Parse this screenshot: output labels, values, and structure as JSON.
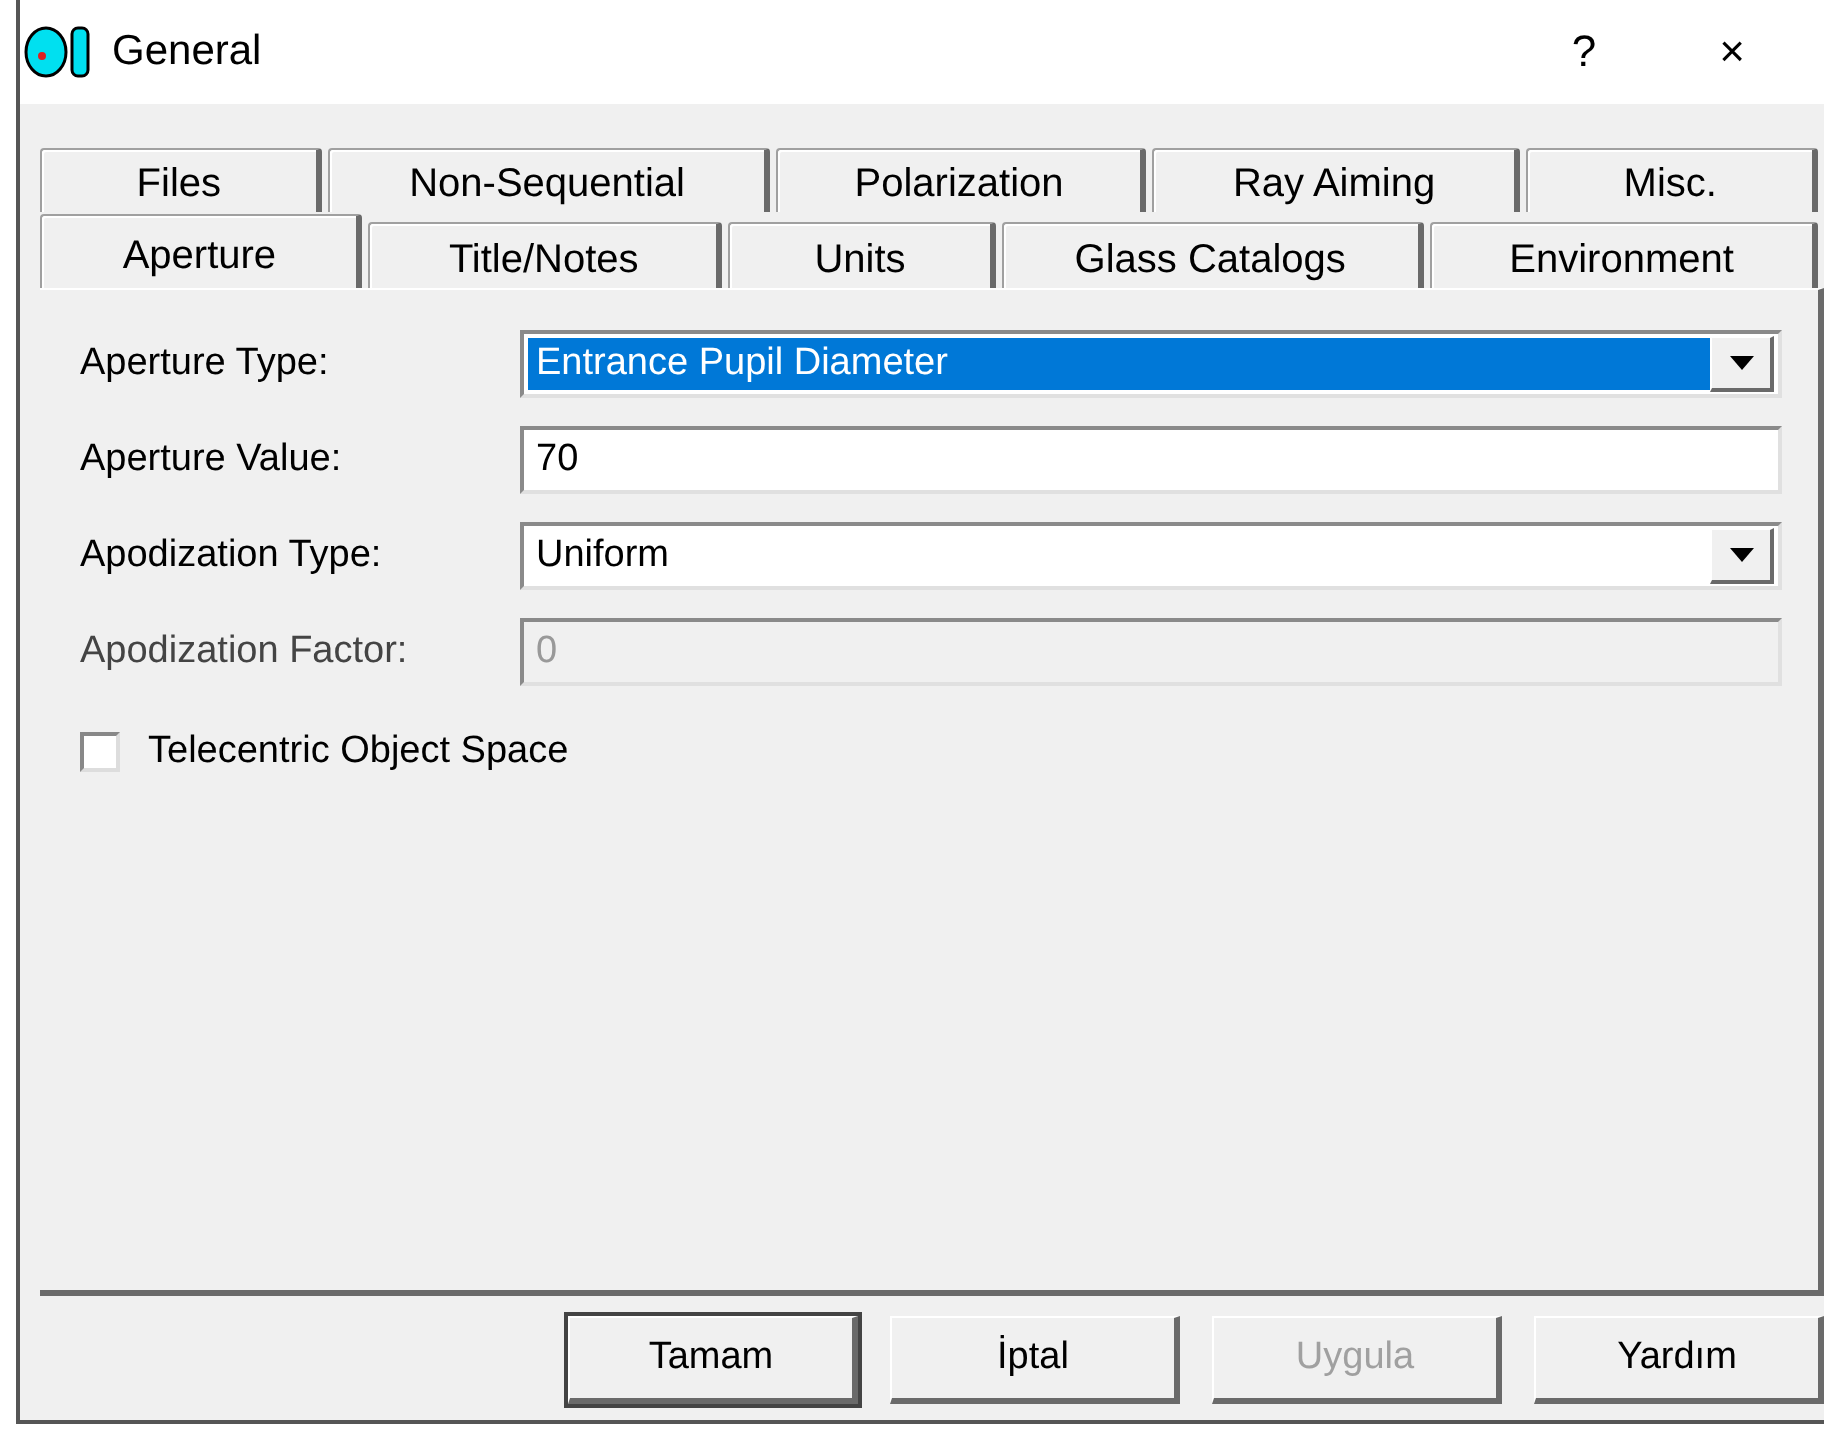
{
  "window": {
    "title": "General",
    "help": "?",
    "close": "×"
  },
  "tab_rows": [
    [
      {
        "label": "Files",
        "selected": false
      },
      {
        "label": "Non-Sequential",
        "selected": false
      },
      {
        "label": "Polarization",
        "selected": false
      },
      {
        "label": "Ray Aiming",
        "selected": false
      },
      {
        "label": "Misc.",
        "selected": false
      }
    ],
    [
      {
        "label": "Aperture",
        "selected": true
      },
      {
        "label": "Title/Notes",
        "selected": false
      },
      {
        "label": "Units",
        "selected": false
      },
      {
        "label": "Glass Catalogs",
        "selected": false
      },
      {
        "label": "Environment",
        "selected": false
      }
    ]
  ],
  "fields": [
    {
      "label": "Aperture Type:",
      "kind": "dropdown",
      "value": "Entrance Pupil Diameter",
      "focused": true,
      "disabled": false
    },
    {
      "label": "Aperture Value:",
      "kind": "text",
      "value": "70",
      "focused": false,
      "disabled": false
    },
    {
      "label": "Apodization Type:",
      "kind": "dropdown",
      "value": "Uniform",
      "focused": false,
      "disabled": false
    },
    {
      "label": "Apodization Factor:",
      "kind": "text",
      "value": "0",
      "focused": false,
      "disabled": true
    }
  ],
  "checkbox": {
    "label": "Telecentric Object Space",
    "checked": false
  },
  "buttons": [
    {
      "label": "Tamam",
      "default": true,
      "disabled": false
    },
    {
      "label": "İptal",
      "default": false,
      "disabled": false
    },
    {
      "label": "Uygula",
      "default": false,
      "disabled": true
    },
    {
      "label": "Yardım",
      "default": false,
      "disabled": false
    }
  ]
}
